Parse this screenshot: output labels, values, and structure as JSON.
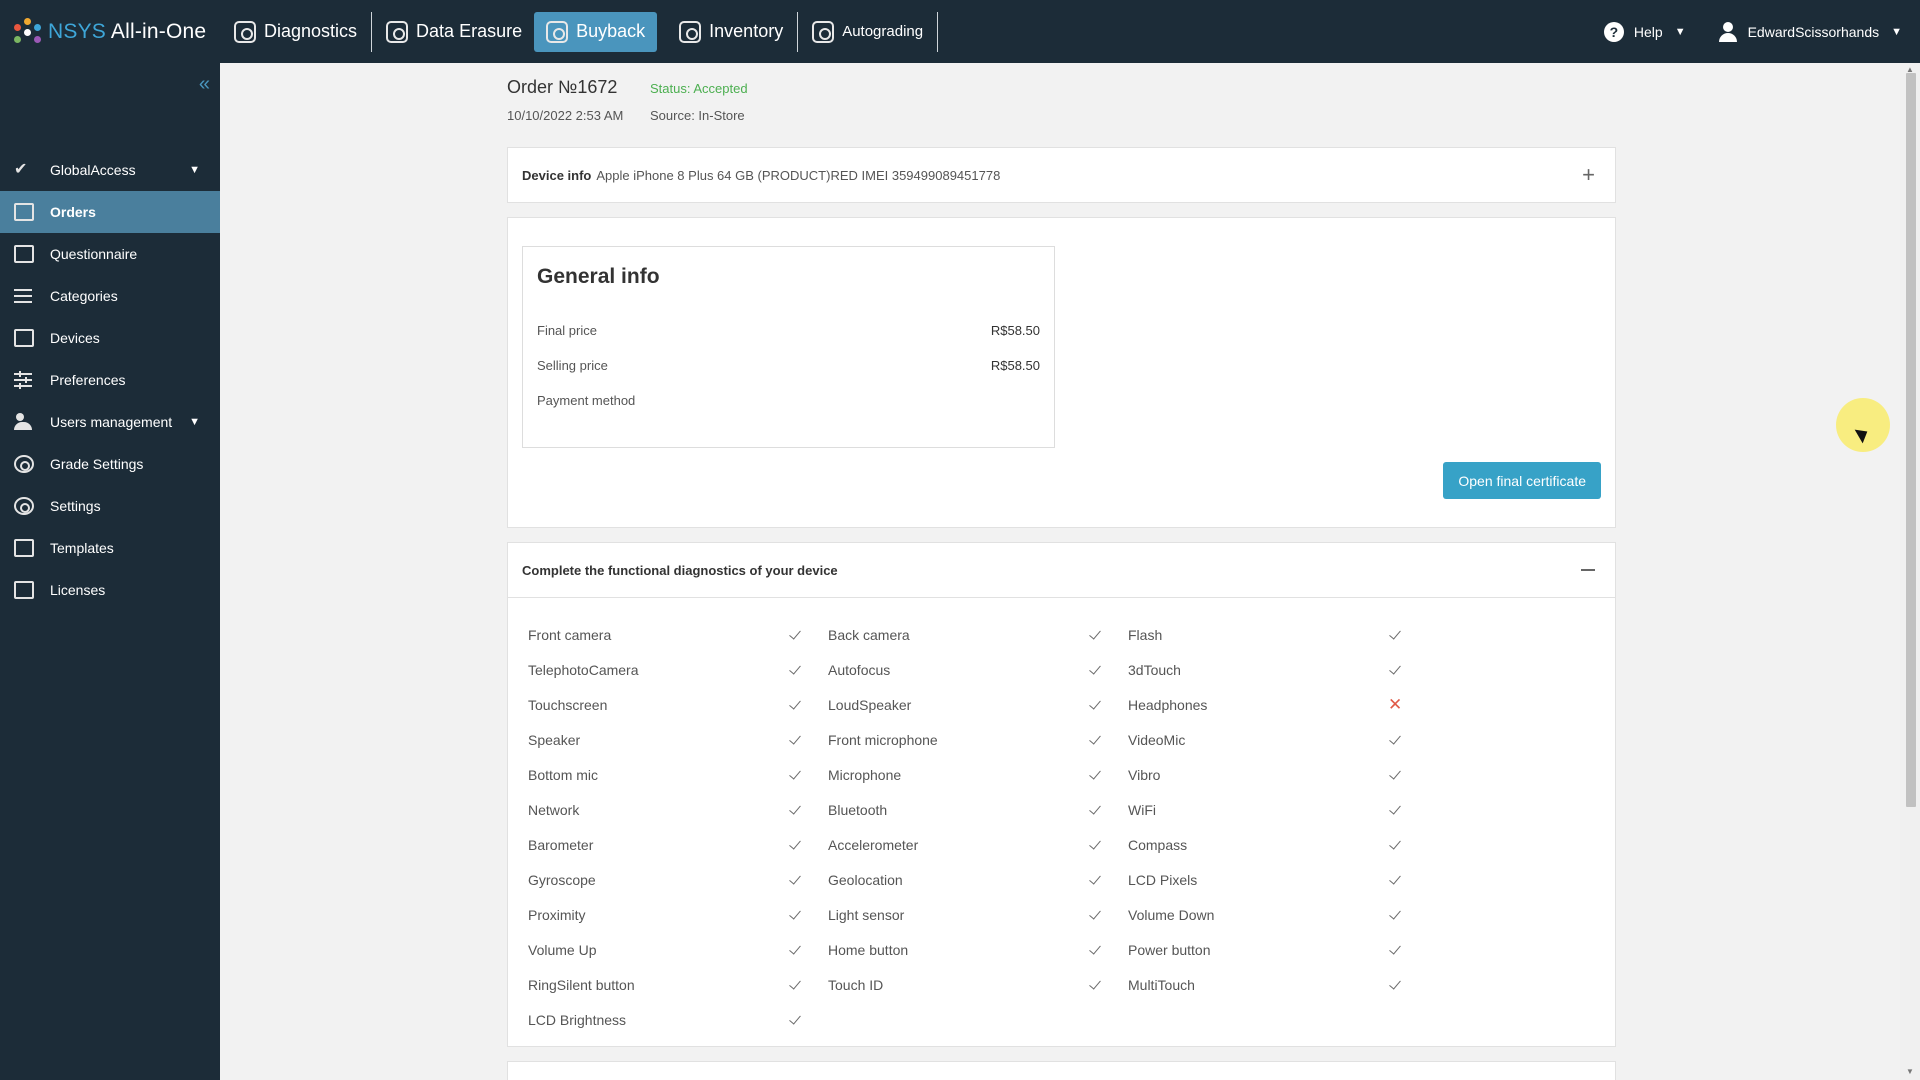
{
  "brand": {
    "prefix": "NSYS",
    "suffix": "All-in-One"
  },
  "nav": {
    "tabs": [
      {
        "label": "Diagnostics",
        "icon": "diagnostics-icon"
      },
      {
        "label": "Data Erasure",
        "icon": "data-erasure-icon"
      },
      {
        "label": "Buyback",
        "icon": "buyback-icon",
        "active": true
      },
      {
        "label": "Inventory",
        "icon": "inventory-icon"
      },
      {
        "label": "Autograding",
        "icon": "autograding-icon"
      }
    ],
    "help_label": "Help",
    "username": "EdwardScissorhands"
  },
  "sidebar": {
    "items": [
      {
        "label": "GlobalAccess",
        "icon": "global-access-icon",
        "has_arrow": true
      },
      {
        "label": "Orders",
        "icon": "orders-icon",
        "active": true
      },
      {
        "label": "Questionnaire",
        "icon": "questionnaire-icon"
      },
      {
        "label": "Categories",
        "icon": "categories-icon"
      },
      {
        "label": "Devices",
        "icon": "devices-icon"
      },
      {
        "label": "Preferences",
        "icon": "preferences-icon"
      },
      {
        "label": "Users management",
        "icon": "users-icon",
        "has_arrow": true
      },
      {
        "label": "Grade Settings",
        "icon": "grade-settings-icon"
      },
      {
        "label": "Settings",
        "icon": "settings-icon"
      },
      {
        "label": "Templates",
        "icon": "templates-icon"
      },
      {
        "label": "Licenses",
        "icon": "licenses-icon"
      }
    ]
  },
  "order": {
    "title": "Order №1672",
    "status": "Status: Accepted",
    "date": "10/10/2022 2:53 AM",
    "source": "Source: In-Store"
  },
  "device_info": {
    "label": "Device info",
    "value": "Apple iPhone 8 Plus 64 GB (PRODUCT)RED IMEI 359499089451778"
  },
  "general_info": {
    "title": "General info",
    "rows": [
      {
        "label": "Final price",
        "value": "R$58.50"
      },
      {
        "label": "Selling price",
        "value": "R$58.50"
      },
      {
        "label": "Payment method",
        "value": ""
      }
    ],
    "certificate_button": "Open final certificate"
  },
  "diagnostics": {
    "title": "Complete the functional diagnostics of your device",
    "items": [
      {
        "name": "Front camera",
        "passed": true
      },
      {
        "name": "Back camera",
        "passed": true
      },
      {
        "name": "Flash",
        "passed": true
      },
      {
        "name": "TelephotoCamera",
        "passed": true
      },
      {
        "name": "Autofocus",
        "passed": true
      },
      {
        "name": "3dTouch",
        "passed": true
      },
      {
        "name": "Touchscreen",
        "passed": true
      },
      {
        "name": "LoudSpeaker",
        "passed": true
      },
      {
        "name": "Headphones",
        "passed": false
      },
      {
        "name": "Speaker",
        "passed": true
      },
      {
        "name": "Front microphone",
        "passed": true
      },
      {
        "name": "VideoMic",
        "passed": true
      },
      {
        "name": "Bottom mic",
        "passed": true
      },
      {
        "name": "Microphone",
        "passed": true
      },
      {
        "name": "Vibro",
        "passed": true
      },
      {
        "name": "Network",
        "passed": true
      },
      {
        "name": "Bluetooth",
        "passed": true
      },
      {
        "name": "WiFi",
        "passed": true
      },
      {
        "name": "Barometer",
        "passed": true
      },
      {
        "name": "Accelerometer",
        "passed": true
      },
      {
        "name": "Compass",
        "passed": true
      },
      {
        "name": "Gyroscope",
        "passed": true
      },
      {
        "name": "Geolocation",
        "passed": true
      },
      {
        "name": "LCD Pixels",
        "passed": true
      },
      {
        "name": "Proximity",
        "passed": true
      },
      {
        "name": "Light sensor",
        "passed": true
      },
      {
        "name": "Volume Down",
        "passed": true
      },
      {
        "name": "Volume Up",
        "passed": true
      },
      {
        "name": "Home button",
        "passed": true
      },
      {
        "name": "Power button",
        "passed": true
      },
      {
        "name": "RingSilent button",
        "passed": true
      },
      {
        "name": "Touch ID",
        "passed": true
      },
      {
        "name": "MultiTouch",
        "passed": true
      },
      {
        "name": "LCD Brightness",
        "passed": true
      }
    ]
  },
  "colors": {
    "topbar": "#1c2c38",
    "accent": "#4a95bd",
    "status_ok": "#4caf50",
    "fail": "#e05a48",
    "button": "#37a2c7"
  }
}
